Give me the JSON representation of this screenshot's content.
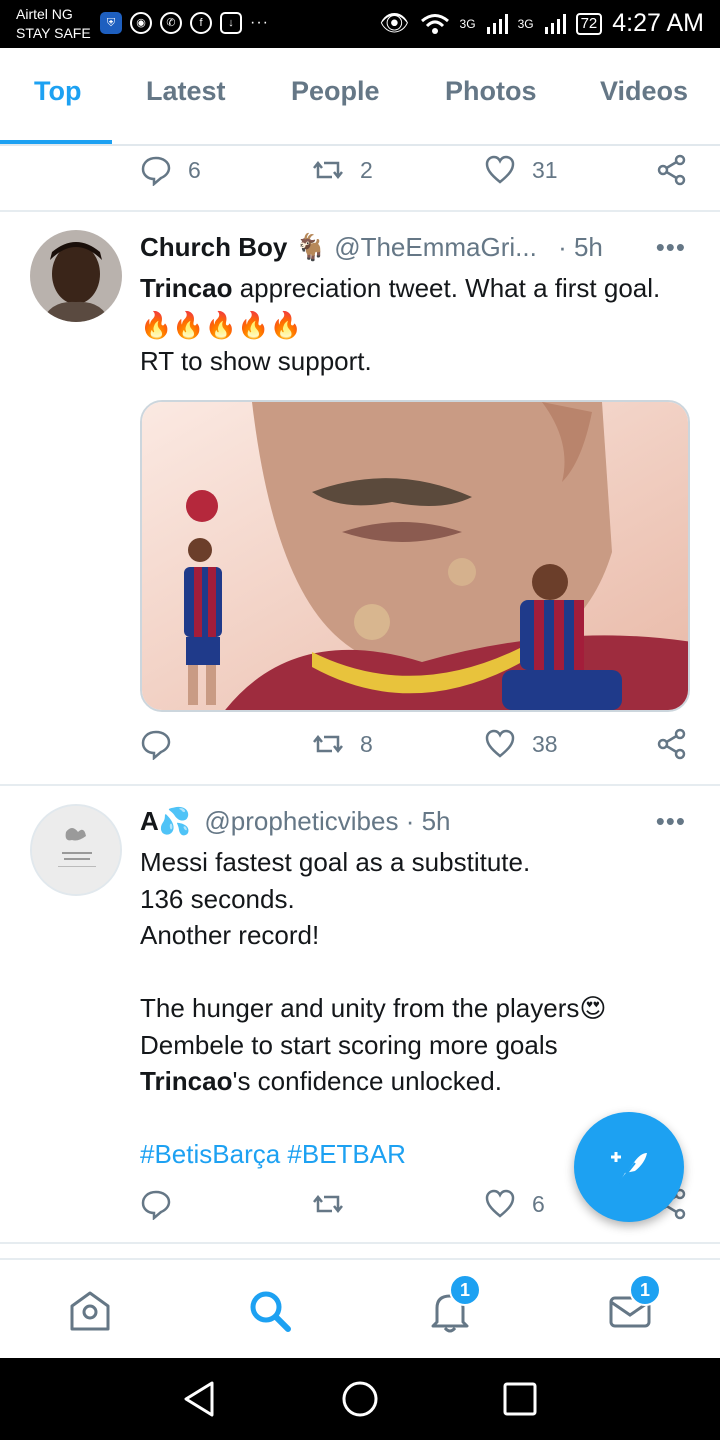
{
  "status_bar": {
    "carrier": "Airtel NG",
    "carrier_sub": "STAY SAFE",
    "net1": "3G",
    "net2": "3G",
    "battery": "72",
    "time": "4:27 AM"
  },
  "tabs": [
    {
      "label": "Top",
      "active": true
    },
    {
      "label": "Latest"
    },
    {
      "label": "People"
    },
    {
      "label": "Photos"
    },
    {
      "label": "Videos"
    }
  ],
  "tweet0": {
    "replies": "6",
    "retweets": "2",
    "likes": "31"
  },
  "tweet1": {
    "name": "Church Boy",
    "name_emoji": "🐐",
    "handle": "@TheEmmaGri...",
    "time": "· 5h",
    "text_bold": "Trincao",
    "text_rest": " appreciation tweet. What a first goal.",
    "fire": "🔥🔥🔥🔥🔥",
    "line2": "RT to show support.",
    "retweets": "8",
    "likes": "38"
  },
  "tweet2": {
    "name": "A",
    "name_emoji": "💦",
    "handle": "@propheticvibes",
    "time": "· 5h",
    "line1": "Messi fastest goal as a substitute.",
    "line2": "136 seconds.",
    "line3": "Another record!",
    "line4": "The hunger and unity from the players",
    "line4_emoji": "😍",
    "line5": "Dembele to start scoring more goals",
    "line6_bold": "Trincao",
    "line6_rest": "'s confidence unlocked.",
    "hashtags": "#BetisBarça #BETBAR",
    "likes": "6"
  },
  "bottom_nav": {
    "notifications_badge": "1",
    "messages_badge": "1"
  },
  "colors": {
    "accent": "#1da1f2",
    "muted": "#657786"
  }
}
